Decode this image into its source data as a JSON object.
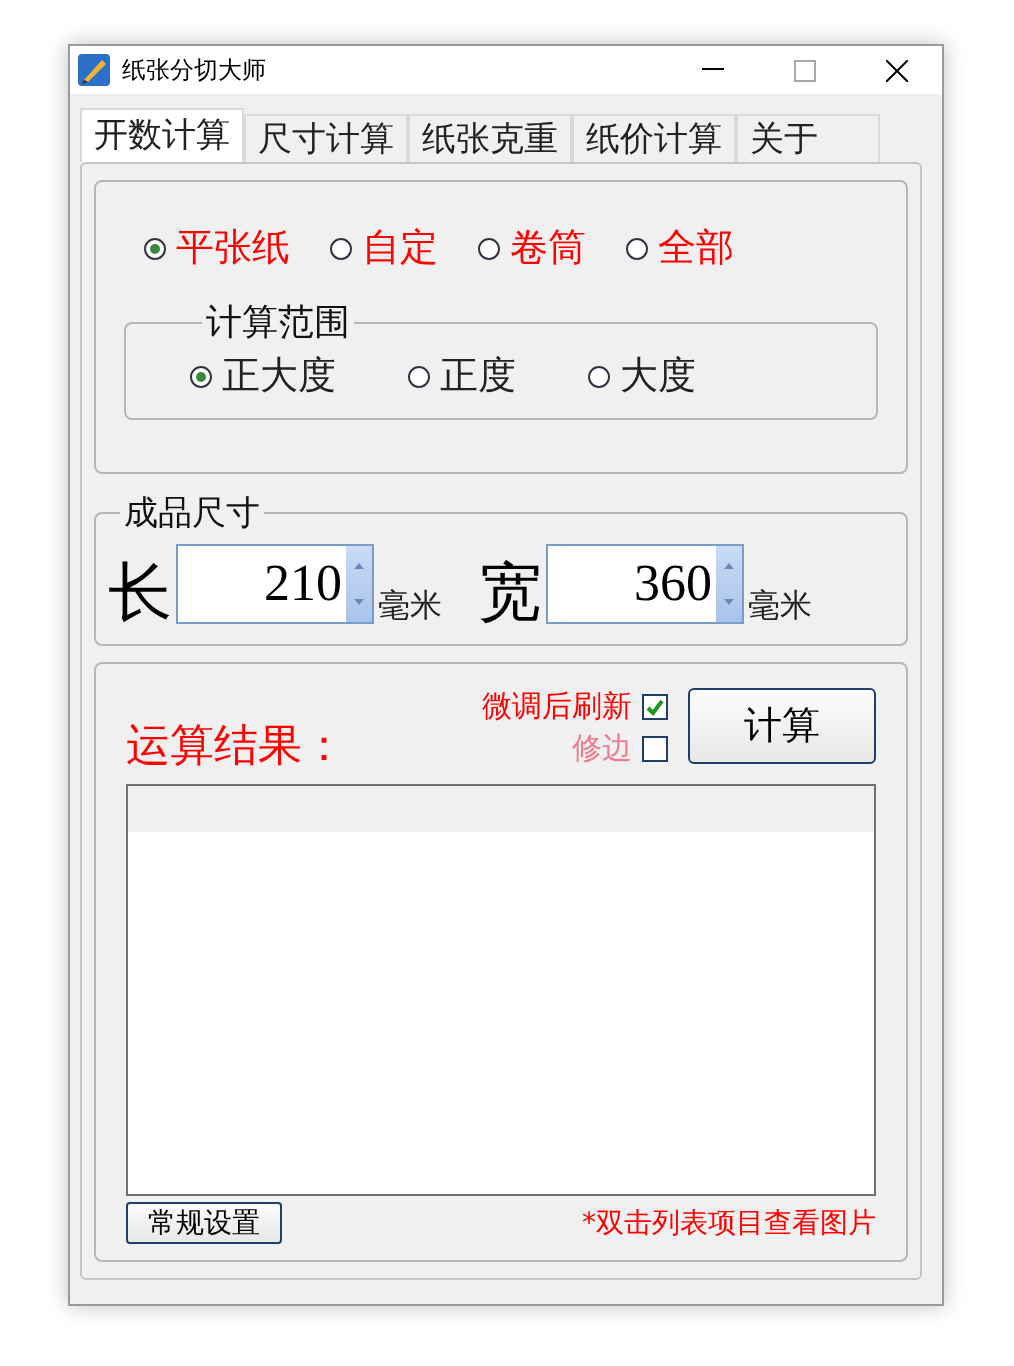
{
  "window": {
    "title": "纸张分切大师"
  },
  "tabs": [
    {
      "label": "开数计算",
      "selected": true
    },
    {
      "label": "尺寸计算",
      "selected": false
    },
    {
      "label": "纸张克重",
      "selected": false
    },
    {
      "label": "纸价计算",
      "selected": false
    },
    {
      "label": "关于",
      "selected": false
    }
  ],
  "paper_types": [
    {
      "label": "平张纸",
      "selected": true
    },
    {
      "label": "自定",
      "selected": false
    },
    {
      "label": "卷筒",
      "selected": false
    },
    {
      "label": "全部",
      "selected": false
    }
  ],
  "range_group": {
    "title": "计算范围",
    "options": [
      {
        "label": "正大度",
        "selected": true
      },
      {
        "label": "正度",
        "selected": false
      },
      {
        "label": "大度",
        "selected": false
      }
    ]
  },
  "size_group": {
    "title": "成品尺寸",
    "fields": [
      {
        "label": "长",
        "value": "210",
        "unit": "毫米"
      },
      {
        "label": "宽",
        "value": "360",
        "unit": "毫米"
      }
    ]
  },
  "result": {
    "title": "运算结果：",
    "options": [
      {
        "label": "微调后刷新",
        "checked": true,
        "disabled": false
      },
      {
        "label": "修边",
        "checked": false,
        "disabled": true
      }
    ],
    "calc_button": "计算",
    "settings_button": "常规设置",
    "note": "*双击列表项目查看图片"
  }
}
